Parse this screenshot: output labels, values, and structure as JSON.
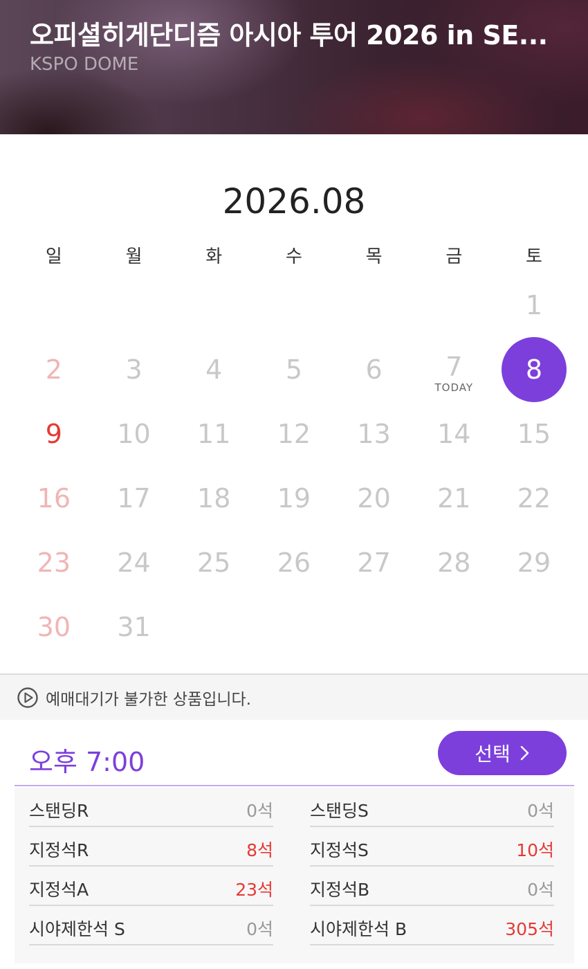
{
  "header": {
    "title": "오피셜히게단디즘 아시아 투어 2026 in SE...",
    "venue": "KSPO DOME"
  },
  "calendar": {
    "month_label": "2026.08",
    "weekdays": [
      "일",
      "월",
      "화",
      "수",
      "목",
      "금",
      "토"
    ],
    "today_label": "TODAY",
    "weeks": [
      [
        "",
        "",
        "",
        "",
        "",
        "",
        "1"
      ],
      [
        "2",
        "3",
        "4",
        "5",
        "6",
        "7",
        "8"
      ],
      [
        "9",
        "10",
        "11",
        "12",
        "13",
        "14",
        "15"
      ],
      [
        "16",
        "17",
        "18",
        "19",
        "20",
        "21",
        "22"
      ],
      [
        "23",
        "24",
        "25",
        "26",
        "27",
        "28",
        "29"
      ],
      [
        "30",
        "31",
        "",
        "",
        "",
        "",
        ""
      ]
    ],
    "today": "7",
    "selected": "8",
    "highlighted_sunday": "9"
  },
  "notice": {
    "icon": "play-circle-icon",
    "text": "예매대기가 불가한 상품입니다."
  },
  "showtime": {
    "time_label": "오후 7:00",
    "select_button": "선택"
  },
  "seats": [
    {
      "name": "스탠딩R",
      "count": "0석",
      "available": false
    },
    {
      "name": "스탠딩S",
      "count": "0석",
      "available": false
    },
    {
      "name": "지정석R",
      "count": "8석",
      "available": true
    },
    {
      "name": "지정석S",
      "count": "10석",
      "available": true
    },
    {
      "name": "지정석A",
      "count": "23석",
      "available": true
    },
    {
      "name": "지정석B",
      "count": "0석",
      "available": false
    },
    {
      "name": "시야제한석 S",
      "count": "0석",
      "available": false
    },
    {
      "name": "시야제한석 B",
      "count": "305석",
      "available": true
    }
  ],
  "colors": {
    "accent": "#7c3fdc",
    "available_red": "#e53935",
    "sunday_dim": "#f0b5b5",
    "disabled_gray": "#c8c8c8"
  }
}
